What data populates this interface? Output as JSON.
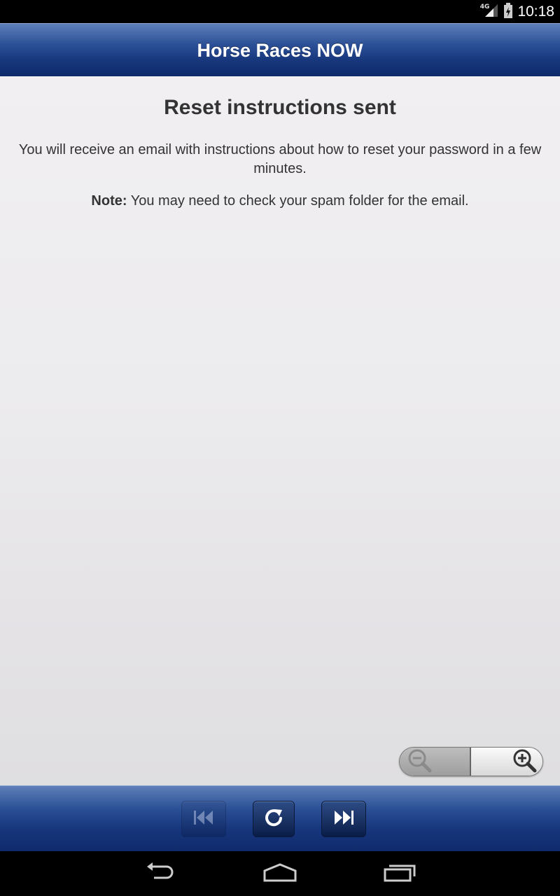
{
  "status_bar": {
    "network_label": "4G",
    "time": "10:18"
  },
  "header": {
    "title": "Horse Races NOW"
  },
  "content": {
    "title": "Reset instructions sent",
    "message": "You will receive an email with instructions about how to reset your password in a few minutes.",
    "note_label": "Note:",
    "note_text": " You may need to check your spam folder for the email."
  },
  "zoom": {
    "out_icon": "zoom-out-icon",
    "in_icon": "zoom-in-icon"
  },
  "toolbar": {
    "buttons": [
      {
        "icon": "skip-back-icon",
        "enabled": false
      },
      {
        "icon": "refresh-icon",
        "enabled": true
      },
      {
        "icon": "skip-forward-icon",
        "enabled": true
      }
    ]
  },
  "navbar": {
    "buttons": [
      "back-icon",
      "home-icon",
      "recent-apps-icon"
    ]
  },
  "colors": {
    "header_blue": "#17367c",
    "text": "#333333",
    "background": "#eceaed"
  }
}
